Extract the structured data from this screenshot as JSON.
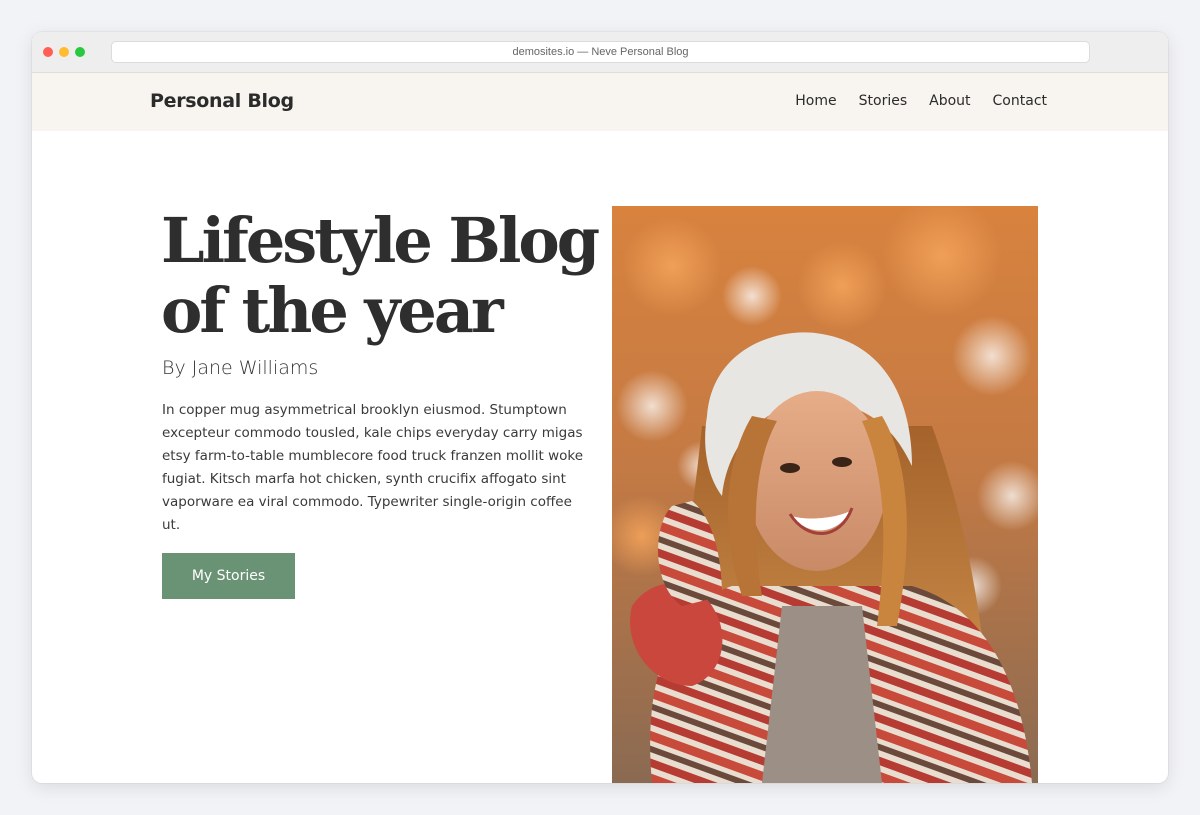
{
  "browser": {
    "url": "demosites.io — Neve Personal Blog",
    "traffic_lights": {
      "close": "#ff5f57",
      "minimize": "#febc2e",
      "maximize": "#28c840"
    }
  },
  "header": {
    "logo": "Personal Blog",
    "nav": [
      "Home",
      "Stories",
      "About",
      "Contact"
    ]
  },
  "hero": {
    "title_line1": "Lifestyle Blog",
    "title_line2": "of the year",
    "byline": "By Jane Williams",
    "intro": "In copper mug asymmetrical brooklyn eiusmod. Stumptown excepteur commodo tousled, kale chips everyday carry migas etsy farm-to-table mumblecore food truck franzen mollit woke fugiat. Kitsch marfa hot chicken, synth crucifix affogato sint vaporware ea viral commodo. Typewriter single-origin coffee ut.",
    "cta_label": "My Stories",
    "image_subject": "smiling woman in white knit hat and red striped cardigan, autumn background"
  },
  "colors": {
    "header_bg": "#f8f5f0",
    "accent_button": "#6a9274",
    "text_dark": "#2e2e2e"
  }
}
